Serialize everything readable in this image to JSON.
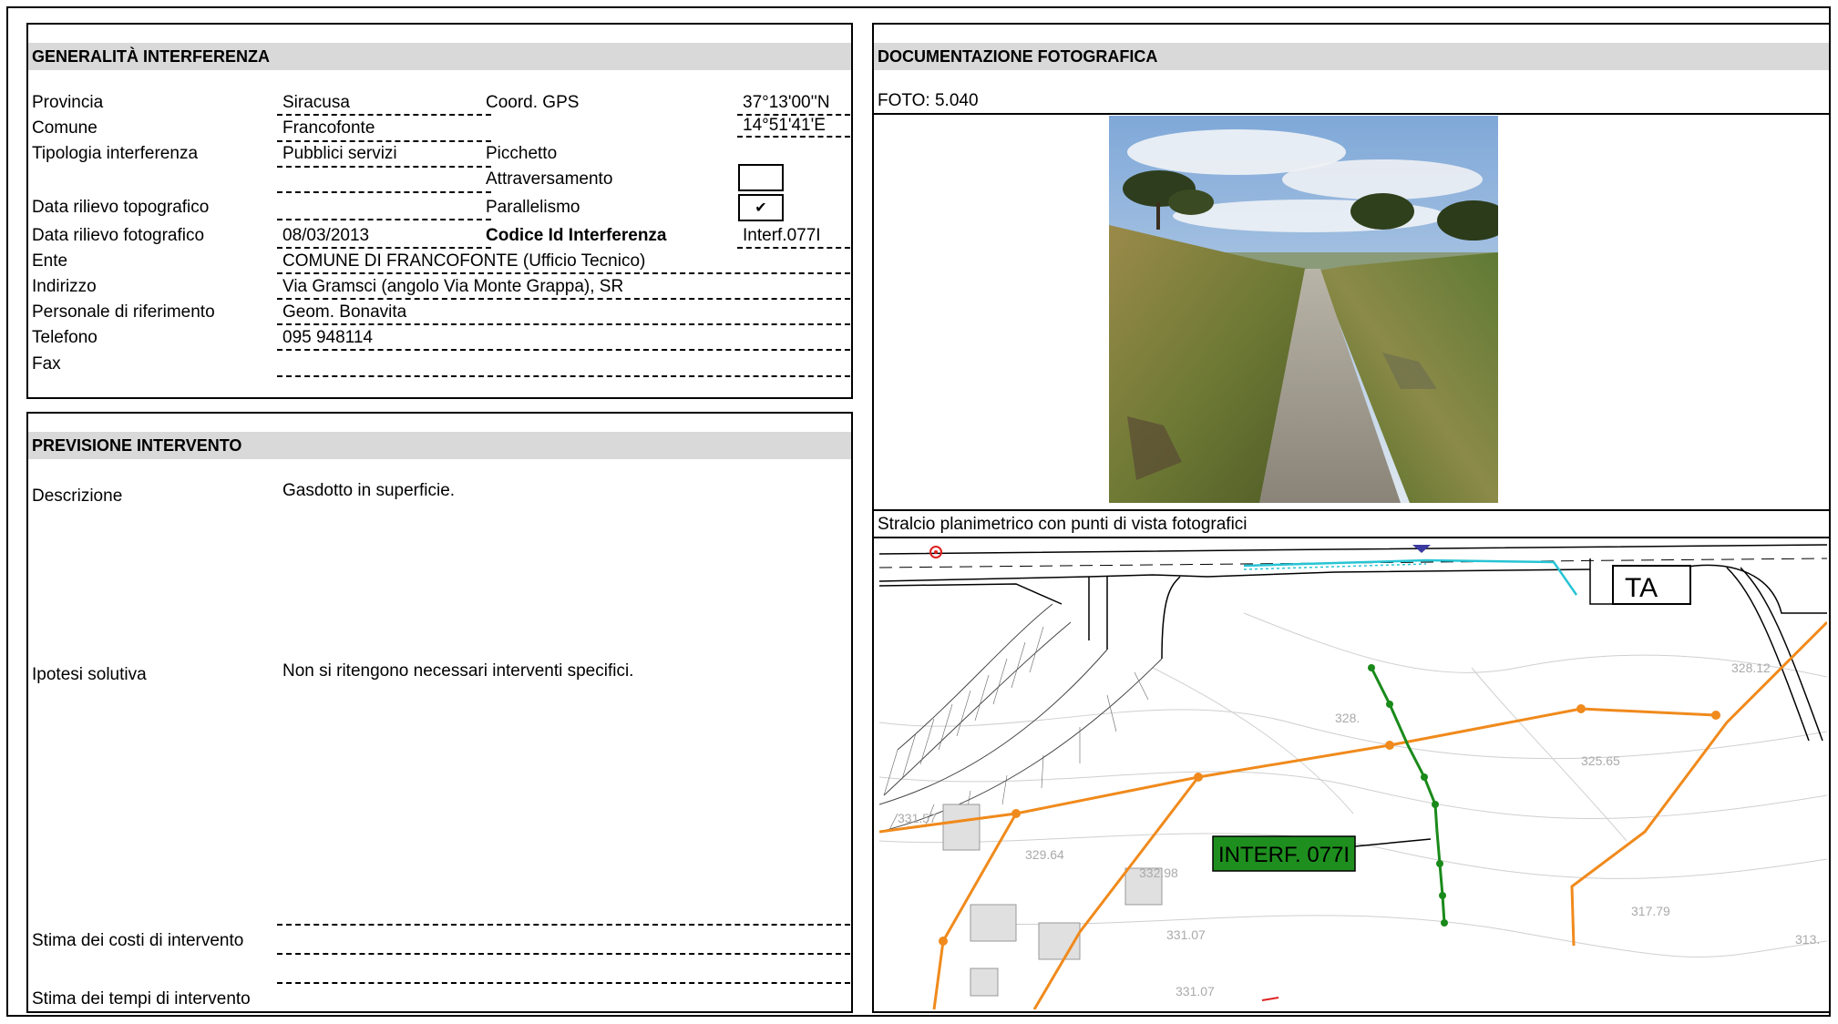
{
  "generalita": {
    "title": "GENERALITÀ  INTERFERENZA",
    "provincia_label": "Provincia",
    "provincia": "Siracusa",
    "comune_label": "Comune",
    "comune": "Francofonte",
    "tipologia_label": "Tipologia interferenza",
    "tipologia": "Pubblici servizi",
    "data_topo_label": "Data rilievo topografico",
    "data_topo": "",
    "data_foto_label": "Data rilievo fotografico",
    "data_foto": "08/03/2013",
    "ente_label": "Ente",
    "ente": "COMUNE DI FRANCOFONTE (Ufficio Tecnico)",
    "indirizzo_label": "Indirizzo",
    "indirizzo": "Via Gramsci (angolo Via Monte Grappa), SR",
    "personale_label": "Personale di riferimento",
    "personale": "Geom. Bonavita",
    "telefono_label": "Telefono",
    "telefono": "095 948114",
    "fax_label": "Fax",
    "fax": "",
    "gps_label": "Coord. GPS",
    "gps_n": "37°13'00''N",
    "gps_e": "14°51'41'E",
    "picchetto_label": "Picchetto",
    "attraversamento_label": "Attraversamento",
    "attraversamento_checked": "",
    "parallelismo_label": "Parallelismo",
    "parallelismo_checked": "✔",
    "codice_label": "Codice Id Interferenza",
    "codice": "Interf.077I"
  },
  "previsione": {
    "title": "PREVISIONE INTERVENTO",
    "descrizione_label": "Descrizione",
    "descrizione": "Gasdotto in superficie.",
    "ipotesi_label": "Ipotesi solutiva",
    "ipotesi": "Non si ritengono necessari interventi specifici.",
    "costi_label": "Stima dei costi di intervento",
    "tempi_label": "Stima dei tempi di intervento"
  },
  "documentazione": {
    "title": "DOCUMENTAZIONE FOTOGRAFICA",
    "foto_label": "FOTO: 5.040",
    "stralcio_label": "Stralcio planimetrico con punti di vista fotografici",
    "map_label_ta": "TA",
    "map_label_interf": "INTERF. 077I",
    "map_elev": [
      "328.12",
      "325.65",
      "329.64",
      "317.79",
      "313.",
      "328.",
      "331.07",
      "331.07",
      "332.98",
      "331.57"
    ]
  },
  "colors": {
    "header_bg": "#d9d9d9",
    "orange_line": "#f08a1c",
    "green_line": "#1a8a1a",
    "interf_box": "#1e8f1e",
    "cyan_line": "#27c4d4"
  }
}
